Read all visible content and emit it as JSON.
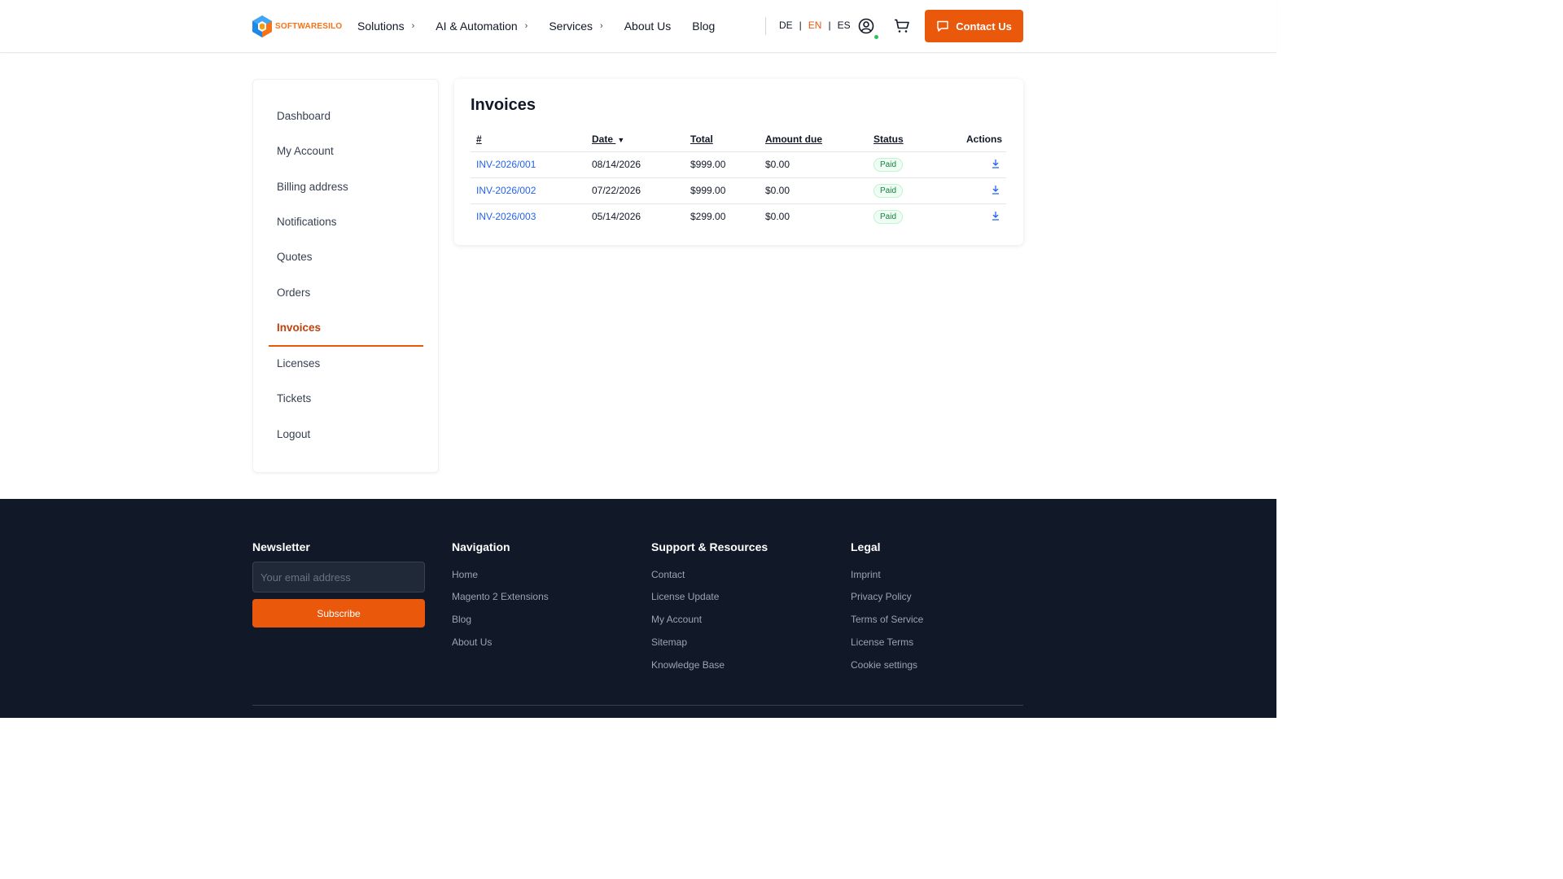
{
  "header": {
    "logo_text": "SOFTWARESILO",
    "nav": [
      {
        "label": "Solutions",
        "has_chevron": true
      },
      {
        "label": "AI & Automation",
        "has_chevron": true
      },
      {
        "label": "Services",
        "has_chevron": true
      },
      {
        "label": "About Us",
        "has_chevron": false
      },
      {
        "label": "Blog",
        "has_chevron": false
      }
    ],
    "chevron": "›",
    "languages": [
      "DE",
      "EN",
      "ES"
    ],
    "active_language": "EN",
    "contact_label": "Contact Us",
    "icons": [
      "user-circle-icon",
      "online-status-dot",
      "shopping-cart-icon",
      "chat-bubble-icon"
    ]
  },
  "sidebar": {
    "items": [
      {
        "label": "Dashboard",
        "active": false
      },
      {
        "label": "My Account",
        "active": false
      },
      {
        "label": "Billing address",
        "active": false
      },
      {
        "label": "Notifications",
        "active": false
      },
      {
        "label": "Quotes",
        "active": false
      },
      {
        "label": "Orders",
        "active": false
      },
      {
        "label": "Invoices",
        "active": true
      },
      {
        "label": "Licenses",
        "active": false
      },
      {
        "label": "Tickets",
        "active": false
      },
      {
        "label": "Logout",
        "active": false
      }
    ]
  },
  "invoices": {
    "title": "Invoices",
    "columns": {
      "number": "#",
      "date": "Date",
      "date_sort_indicator": "▼",
      "total": "Total",
      "amount_due": "Amount due",
      "status": "Status",
      "actions": "Actions"
    },
    "rows": [
      {
        "number": "INV-2026/001",
        "date": "08/14/2026",
        "total": "$999.00",
        "amount_due": "$0.00",
        "status": "Paid"
      },
      {
        "number": "INV-2026/002",
        "date": "07/22/2026",
        "total": "$999.00",
        "amount_due": "$0.00",
        "status": "Paid"
      },
      {
        "number": "INV-2026/003",
        "date": "05/14/2026",
        "total": "$299.00",
        "amount_due": "$0.00",
        "status": "Paid"
      }
    ],
    "action_icon": "download-icon"
  },
  "footer": {
    "newsletter": {
      "heading": "Newsletter",
      "placeholder": "Your email address",
      "value": "",
      "button": "Subscribe"
    },
    "navigation": {
      "heading": "Navigation",
      "links": [
        "Home",
        "Magento 2 Extensions",
        "Blog",
        "About Us"
      ]
    },
    "support": {
      "heading": "Support & Resources",
      "links": [
        "Contact",
        "License Update",
        "My Account",
        "Sitemap",
        "Knowledge Base"
      ]
    },
    "legal": {
      "heading": "Legal",
      "links": [
        "Imprint",
        "Privacy Policy",
        "Terms of Service",
        "License Terms",
        "Cookie settings"
      ]
    }
  },
  "colors": {
    "accent": "#ea580c",
    "link": "#2563eb",
    "footer_bg": "#111827",
    "paid_badge": "#15803d"
  }
}
